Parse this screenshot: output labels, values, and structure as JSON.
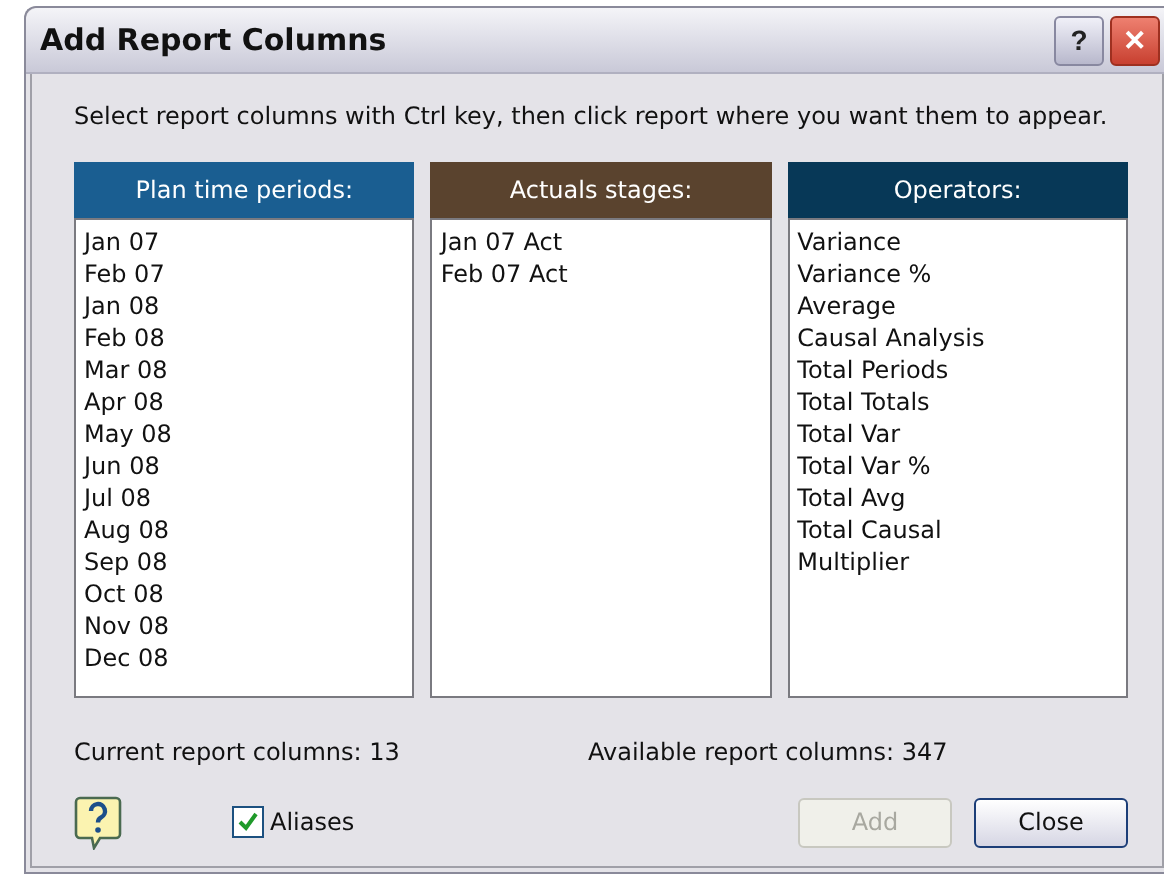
{
  "window": {
    "title": "Add Report Columns",
    "title_buttons": [
      {
        "kind": "help",
        "label": "?"
      },
      {
        "kind": "close",
        "label": "✕"
      }
    ]
  },
  "instruction": "Select report columns with Ctrl key, then click report where you want them to appear.",
  "lists": [
    {
      "header": "Plan time periods:",
      "color": "#1a5e91",
      "items": [
        "Jan 07",
        "Feb 07",
        "Jan 08",
        "Feb 08",
        "Mar 08",
        "Apr 08",
        "May 08",
        "Jun 08",
        "Jul 08",
        "Aug 08",
        "Sep 08",
        "Oct 08",
        "Nov 08",
        "Dec 08"
      ]
    },
    {
      "header": "Actuals stages:",
      "color": "#5a432e",
      "items": [
        "Jan 07 Act",
        "Feb 07 Act"
      ]
    },
    {
      "header": "Operators:",
      "color": "#073857",
      "items": [
        "Variance",
        "Variance %",
        "Average",
        "Causal Analysis",
        "Total Periods",
        "Total Totals",
        "Total Var",
        "Total Var %",
        "Total Avg",
        "Total Causal",
        "Multiplier"
      ]
    }
  ],
  "current_columns": "Current report columns: 13",
  "available_columns": "Available report columns: 347",
  "aliases": {
    "label": "Aliases",
    "checked": true
  },
  "buttons": [
    {
      "label": "Add",
      "disabled": true
    },
    {
      "label": "Close",
      "disabled": false
    }
  ]
}
